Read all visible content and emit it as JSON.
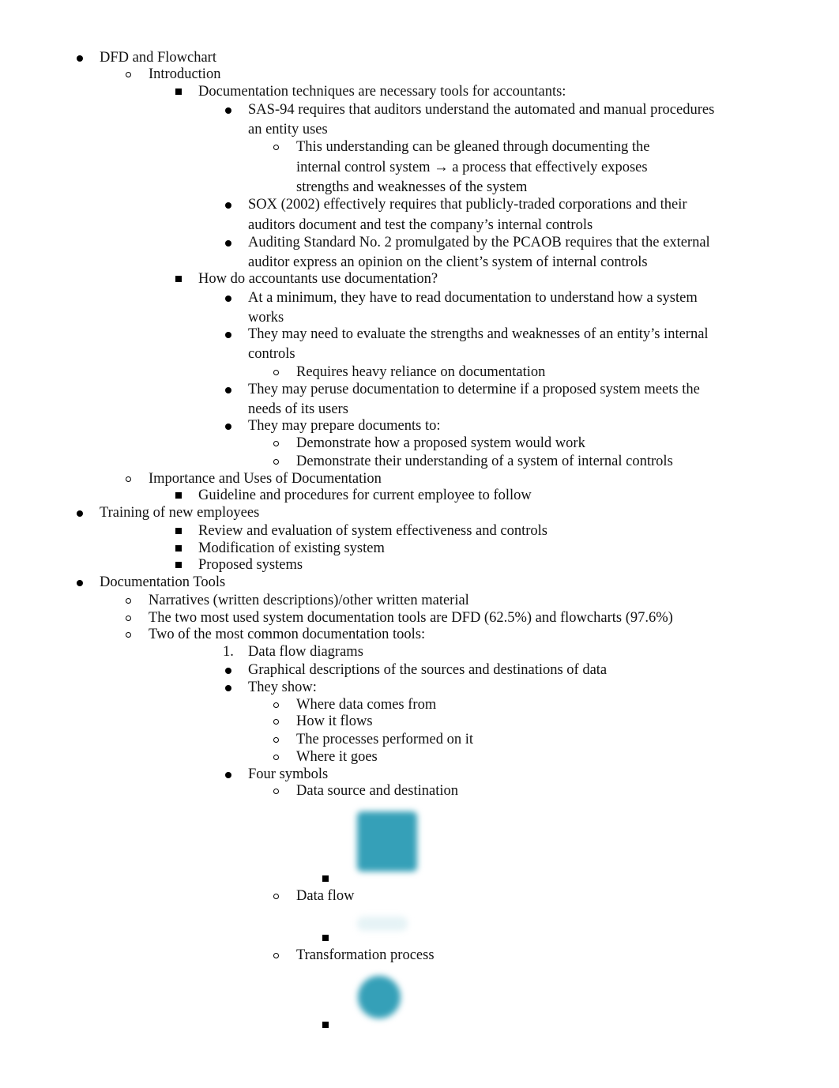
{
  "document": {
    "items": [
      {
        "level": 1,
        "marker": "disc",
        "lines": [
          "DFD and Flowchart"
        ]
      },
      {
        "level": 2,
        "marker": "circle",
        "lines": [
          "Introduction"
        ]
      },
      {
        "level": 3,
        "marker": "square",
        "lines": [
          "Documentation techniques are necessary tools for accountants:"
        ]
      },
      {
        "level": 4,
        "marker": "disc",
        "lines": [
          "SAS-94  requires that auditors understand the automated and manual procedures",
          "an entity uses"
        ]
      },
      {
        "level": 5,
        "marker": "circle",
        "lines": [
          "This understanding can be gleaned through documenting the",
          "internal control system → a process that effectively exposes",
          "strengths and weaknesses of the system"
        ]
      },
      {
        "level": 4,
        "marker": "disc",
        "lines": [
          "SOX (2002)   effectively requires that publicly-traded corporations and their",
          "auditors document and test the company’s internal controls"
        ]
      },
      {
        "level": 4,
        "marker": "disc",
        "lines": [
          "Auditing Standard No. 2        promulgated by the PCAOB requires that the external",
          "auditor express an opinion on the client’s system of internal controls"
        ]
      },
      {
        "level": 3,
        "marker": "square",
        "lines": [
          "How do accountants use documentation?"
        ]
      },
      {
        "level": 4,
        "marker": "disc",
        "lines": [
          "At a minimum, they have to read documentation to understand how a system",
          "works"
        ]
      },
      {
        "level": 4,
        "marker": "disc",
        "lines": [
          "They may need to evaluate the strengths and weaknesses of an entity’s internal",
          "controls"
        ]
      },
      {
        "level": 5,
        "marker": "circle",
        "lines": [
          "Requires heavy reliance on documentation"
        ]
      },
      {
        "level": 4,
        "marker": "disc",
        "lines": [
          "They may peruse documentation to determine if a proposed system meets the",
          "needs of its users"
        ]
      },
      {
        "level": 4,
        "marker": "disc",
        "lines": [
          "They may prepare documents to:"
        ]
      },
      {
        "level": 5,
        "marker": "circle",
        "lines": [
          "Demonstrate how a proposed system would work"
        ]
      },
      {
        "level": 5,
        "marker": "circle",
        "lines": [
          "Demonstrate their understanding of a system of internal controls"
        ]
      },
      {
        "level": 2,
        "marker": "circle",
        "lines": [
          "Importance and Uses of Documentation"
        ]
      },
      {
        "level": 3,
        "marker": "square",
        "lines": [
          "Guideline and procedures for current employee to follow"
        ]
      },
      {
        "level": 1,
        "marker": "disc",
        "lines": [
          "Training of new employees"
        ]
      },
      {
        "level": 3,
        "marker": "square",
        "lines": [
          "Review and evaluation of system effectiveness and controls"
        ]
      },
      {
        "level": 3,
        "marker": "square",
        "lines": [
          "Modification of existing system"
        ]
      },
      {
        "level": 3,
        "marker": "square",
        "lines": [
          "Proposed systems"
        ]
      },
      {
        "level": 1,
        "marker": "disc",
        "lines": [
          "Documentation Tools"
        ]
      },
      {
        "level": 2,
        "marker": "circle",
        "lines": [
          "Narratives (written descriptions)/other written material"
        ]
      },
      {
        "level": 2,
        "marker": "circle",
        "lines": [
          "The two most used system documentation tools are DFD (62.5%) and flowcharts (97.6%)"
        ]
      },
      {
        "level": 2,
        "marker": "circle",
        "lines": [
          "Two of the most common documentation tools:"
        ]
      },
      {
        "level": 4,
        "marker": "number",
        "number": "1.",
        "lines": [
          "Data flow diagrams"
        ]
      },
      {
        "level": 4,
        "marker": "disc",
        "lines": [
          "Graphical descriptions of the sources and destinations of data"
        ]
      },
      {
        "level": 4,
        "marker": "disc",
        "lines": [
          "They show:"
        ]
      },
      {
        "level": 5,
        "marker": "circle",
        "lines": [
          "Where data comes from"
        ]
      },
      {
        "level": 5,
        "marker": "circle",
        "lines": [
          "How it flows"
        ]
      },
      {
        "level": 5,
        "marker": "circle",
        "lines": [
          "The processes performed on it"
        ]
      },
      {
        "level": 5,
        "marker": "circle",
        "lines": [
          "Where it goes"
        ]
      },
      {
        "level": 4,
        "marker": "disc",
        "lines": [
          "Four symbols"
        ]
      },
      {
        "level": 5,
        "marker": "circle",
        "lines": [
          "Data source and destination"
        ]
      },
      {
        "level": 5,
        "marker": "circle",
        "lines": [
          "Data flow"
        ]
      },
      {
        "level": 5,
        "marker": "circle",
        "lines": [
          "Transformation process"
        ]
      }
    ],
    "symbol_images": [
      {
        "name": "data-source-destination-symbol",
        "shape": "square",
        "color": "#35a0b8"
      },
      {
        "name": "data-flow-symbol",
        "shape": "arrow",
        "color": "#e6f3f6"
      },
      {
        "name": "transformation-process-symbol",
        "shape": "circle",
        "color": "#35a0b8"
      }
    ]
  }
}
